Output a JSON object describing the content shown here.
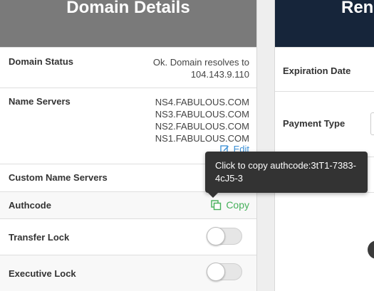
{
  "left_panel": {
    "title": "Domain Details",
    "status": {
      "label": "Domain Status",
      "value_line1": "Ok. Domain resolves to",
      "value_line2": "104.143.9.110"
    },
    "name_servers": {
      "label": "Name Servers",
      "servers": [
        "NS4.FABULOUS.COM",
        "NS3.FABULOUS.COM",
        "NS2.FABULOUS.COM",
        "NS1.FABULOUS.COM"
      ],
      "edit_label": "Edit"
    },
    "custom_name_servers": {
      "label": "Custom Name Servers"
    },
    "authcode": {
      "label": "Authcode",
      "copy_label": "Copy"
    },
    "transfer_lock": {
      "label": "Transfer Lock",
      "enabled": false
    },
    "executive_lock": {
      "label": "Executive Lock",
      "enabled": false
    }
  },
  "right_panel": {
    "title": "Rene",
    "expiration": {
      "label": "Expiration Date"
    },
    "payment": {
      "label": "Payment Type"
    }
  },
  "tooltip": {
    "text": "Click to copy authcode:3tT1-7383-4cJ5-3"
  },
  "colors": {
    "left_header": "#7a7a7a",
    "right_header": "#16253a",
    "edit_link": "#3a8fd6",
    "copy_link": "#45b05a",
    "tooltip_bg": "#333333"
  },
  "icons": {
    "edit": "edit-icon",
    "copy": "copy-icon"
  }
}
